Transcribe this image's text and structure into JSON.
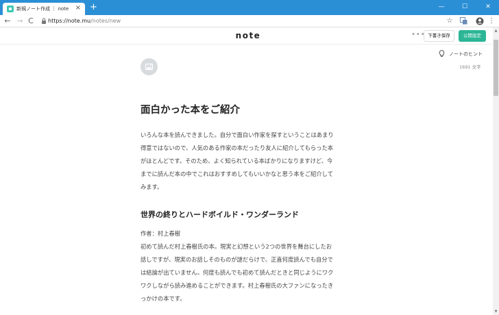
{
  "browser": {
    "tab_title": "新規ノート作成 ｜ note",
    "tab_close": "×",
    "new_tab": "+",
    "window_controls": {
      "minimize": "—",
      "maximize": "☐",
      "close": "✕"
    },
    "nav": {
      "back": "←",
      "forward": "→",
      "reload": "C"
    },
    "url_host": "https://note.mu",
    "url_path": "/notes/new",
    "star": "☆",
    "menu": "⋮",
    "accent_color": "#2b8fd6"
  },
  "header": {
    "logo": "note",
    "more": "•••",
    "draft_label": "下書き保存",
    "publish_label": "公開設定",
    "publish_color": "#2cb696"
  },
  "meta": {
    "hint_label": "ノートのヒント",
    "char_count": "1691 文字"
  },
  "article": {
    "title": "面白かった本をご紹介",
    "intro_lines": [
      "いろんな本を読んできました。自分で面白い作家を探すということはあまり",
      "得意ではないので、人気のある作家の本だったり友人に紹介してもらった本",
      "がほとんどです。そのため、よく知られている本ばかりになりますけど、今",
      "までに読んだ本の中でこれはおすすめしてもいいかなと思う本をご紹介して",
      "みます。"
    ],
    "section_heading": "世界の終りとハードボイルド・ワンダーランド",
    "section_lines": [
      "作者：村上春樹",
      "初めて読んだ村上春樹氏の本。現実と幻想という2つの世界を舞台にしたお",
      "話しですが、現実のお話しそのものが謎だらけで、正直何度読んでも自分で",
      "は結論が出ていません。何度も読んでも初めて読んだときと同じようにワク",
      "ワクしながら読み進めることができます。村上春樹氏の大ファンになったき",
      "っかけの本です。"
    ]
  }
}
